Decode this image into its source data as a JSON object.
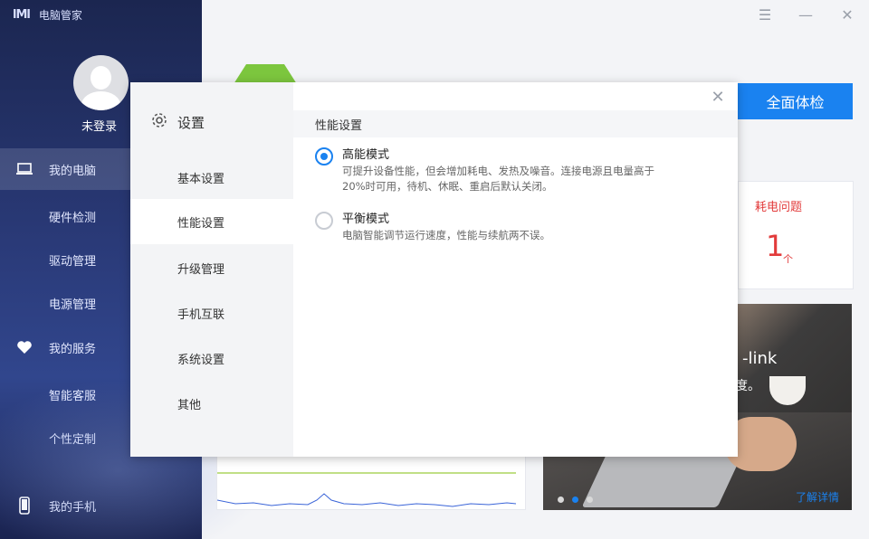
{
  "app": {
    "title": "电脑管家",
    "logo_text": "lMl"
  },
  "window_controls": {
    "menu": "☰",
    "minimize": "—",
    "close": "✕"
  },
  "user": {
    "login_label": "未登录"
  },
  "sidebar": {
    "items": [
      {
        "label": "我的电脑",
        "icon": "laptop-icon"
      },
      {
        "label": "硬件检测"
      },
      {
        "label": "驱动管理"
      },
      {
        "label": "电源管理"
      },
      {
        "label": "我的服务",
        "icon": "heart-icon"
      },
      {
        "label": "智能客服"
      },
      {
        "label": "个性定制"
      },
      {
        "label": "我的手机",
        "icon": "phone-icon"
      }
    ]
  },
  "main": {
    "check_button": "全面体检",
    "power_card": {
      "title": "耗电问题",
      "count": "1",
      "unit": "个"
    },
    "promo": {
      "headline": "-link",
      "subline": "度。",
      "more_link": "了解详情"
    }
  },
  "dialog": {
    "title": "设置",
    "close": "✕",
    "menu": [
      "基本设置",
      "性能设置",
      "升级管理",
      "手机互联",
      "系统设置",
      "其他"
    ],
    "active_index": 1,
    "section_title": "性能设置",
    "options": [
      {
        "title": "高能模式",
        "desc": "可提升设备性能，但会增加耗电、发热及噪音。连接电源且电量高于20%时可用，待机、休眠、重启后默认关闭。",
        "checked": true
      },
      {
        "title": "平衡模式",
        "desc": "电脑智能调节运行速度，性能与续航两不误。",
        "checked": false
      }
    ]
  },
  "colors": {
    "accent": "#1a82f0",
    "danger": "#e23b3b",
    "sidebar_top": "#1b2650",
    "sidebar_mid": "#31468d",
    "green": "#7cc63e"
  }
}
